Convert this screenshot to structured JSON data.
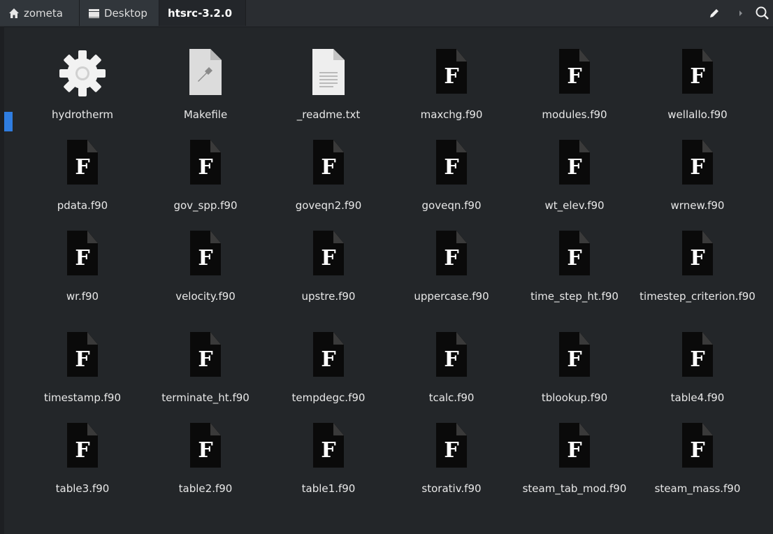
{
  "breadcrumb": {
    "home_label": "zometa",
    "desktop_label": "Desktop",
    "current_label": "htsrc-3.2.0"
  },
  "icons": {
    "home": "home-icon",
    "desktop": "desktop-icon",
    "edit": "pencil-icon",
    "separator": "chevron-right-icon",
    "search": "search-icon"
  },
  "colors": {
    "background": "#232629",
    "accent": "#2f7de0"
  },
  "files": [
    {
      "name": "hydrotherm",
      "type": "executable"
    },
    {
      "name": "Makefile",
      "type": "makefile"
    },
    {
      "name": "_readme.txt",
      "type": "text"
    },
    {
      "name": "maxchg.f90",
      "type": "fortran"
    },
    {
      "name": "modules.f90",
      "type": "fortran"
    },
    {
      "name": "wellallo.f90",
      "type": "fortran"
    },
    {
      "name": "pdata.f90",
      "type": "fortran"
    },
    {
      "name": "gov_spp.f90",
      "type": "fortran"
    },
    {
      "name": "goveqn2.f90",
      "type": "fortran"
    },
    {
      "name": "goveqn.f90",
      "type": "fortran"
    },
    {
      "name": "wt_elev.f90",
      "type": "fortran"
    },
    {
      "name": "wrnew.f90",
      "type": "fortran"
    },
    {
      "name": "wr.f90",
      "type": "fortran"
    },
    {
      "name": "velocity.f90",
      "type": "fortran"
    },
    {
      "name": "upstre.f90",
      "type": "fortran"
    },
    {
      "name": "uppercase.f90",
      "type": "fortran"
    },
    {
      "name": "time_step_ht.f90",
      "type": "fortran"
    },
    {
      "name": "timestep_criterion.f90",
      "type": "fortran"
    },
    {
      "name": "timestamp.f90",
      "type": "fortran"
    },
    {
      "name": "terminate_ht.f90",
      "type": "fortran"
    },
    {
      "name": "tempdegc.f90",
      "type": "fortran"
    },
    {
      "name": "tcalc.f90",
      "type": "fortran"
    },
    {
      "name": "tblookup.f90",
      "type": "fortran"
    },
    {
      "name": "table4.f90",
      "type": "fortran"
    },
    {
      "name": "table3.f90",
      "type": "fortran"
    },
    {
      "name": "table2.f90",
      "type": "fortran"
    },
    {
      "name": "table1.f90",
      "type": "fortran"
    },
    {
      "name": "storativ.f90",
      "type": "fortran"
    },
    {
      "name": "steam_tab_mod.f90",
      "type": "fortran"
    },
    {
      "name": "steam_mass.f90",
      "type": "fortran"
    }
  ],
  "fortran_icon_letter": "F"
}
